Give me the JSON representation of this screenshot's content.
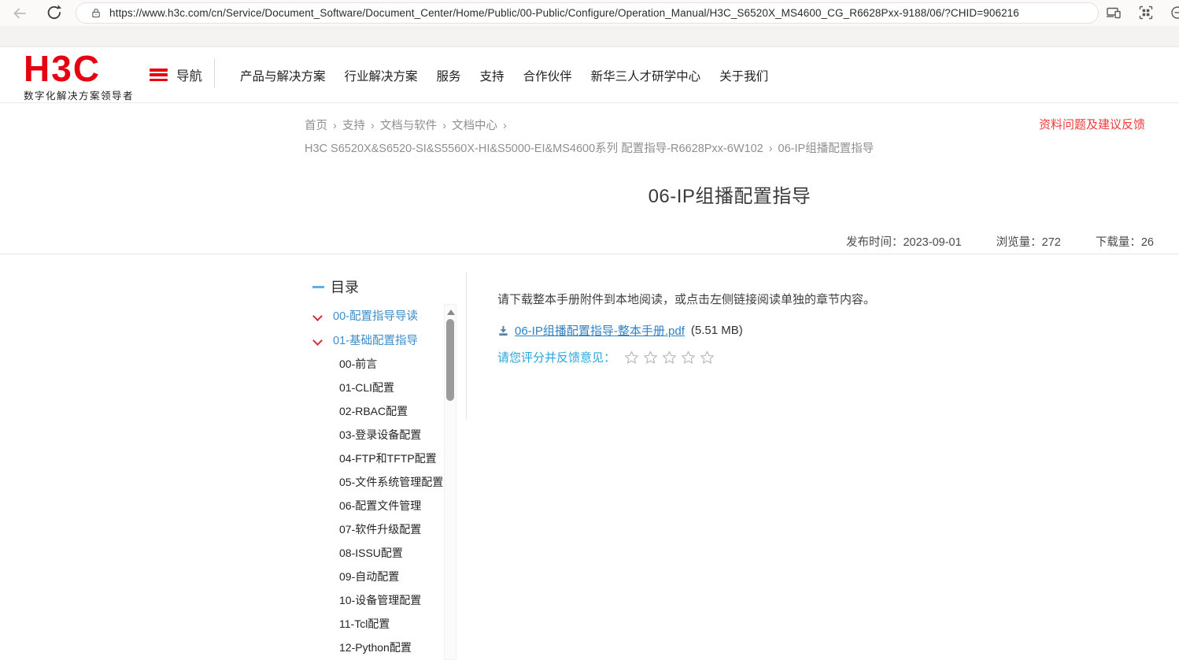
{
  "browser": {
    "url": "https://www.h3c.com/cn/Service/Document_Software/Document_Center/Home/Public/00-Public/Configure/Operation_Manual/H3C_S6520X_MS4600_CG_R6628Pxx-9188/06/?CHID=906216"
  },
  "header": {
    "logo_text": "H3C",
    "logo_tagline": "数字化解决方案领导者",
    "nav_toggle_label": "导航",
    "nav_items": [
      "产品与解决方案",
      "行业解决方案",
      "服务",
      "支持",
      "合作伙伴",
      "新华三人才研学中心",
      "关于我们"
    ]
  },
  "breadcrumb": {
    "separator": "›",
    "line1": [
      "首页",
      "支持",
      "文档与软件",
      "文档中心"
    ],
    "line2_product": "H3C S6520X&S6520-SI&S5560X-HI&S5000-EI&MS4600系列 配置指导-R6628Pxx-6W102",
    "line2_current": "06-IP组播配置指导"
  },
  "feedback_link": "资料问题及建议反馈",
  "page": {
    "title": "06-IP组播配置指导",
    "publish_label": "发布时间：",
    "publish_date": "2023-09-01",
    "views_label": "浏览量：",
    "views_count": "272",
    "downloads_label": "下载量：",
    "downloads_count": "26"
  },
  "toc": {
    "title": "目录",
    "expanded_items": [
      "00-配置指导导读",
      "01-基础配置指导"
    ],
    "chapters": [
      "00-前言",
      "01-CLI配置",
      "02-RBAC配置",
      "03-登录设备配置",
      "04-FTP和TFTP配置",
      "05-文件系统管理配置",
      "06-配置文件管理",
      "07-软件升级配置",
      "08-ISSU配置",
      "09-自动配置",
      "10-设备管理配置",
      "11-Tcl配置",
      "12-Python配置"
    ]
  },
  "content": {
    "instruction": "请下载整本手册附件到本地阅读，或点击左侧链接阅读单独的章节内容。",
    "pdf_link_text": "06-IP组播配置指导-整本手册.pdf",
    "pdf_size": "(5.51 MB)",
    "rating_label": "请您评分并反馈意见：",
    "star_count": 5
  },
  "icons": {
    "back": "back-arrow",
    "refresh": "refresh",
    "lock": "padlock",
    "devices": "devices-preview",
    "grid": "apps-grid",
    "zoomout": "zoom-out",
    "hamburger": "menu",
    "chevron": "chevron-down",
    "download": "download",
    "star": "star-outline"
  },
  "colors": {
    "brand_red": "#e60012",
    "feedback_red": "#ef3b3b",
    "toc_link_blue": "#3e8cc9",
    "pdf_link_blue": "#2f81c4",
    "rating_blue": "#2aa6de",
    "chevron_red": "#d22f3c"
  }
}
